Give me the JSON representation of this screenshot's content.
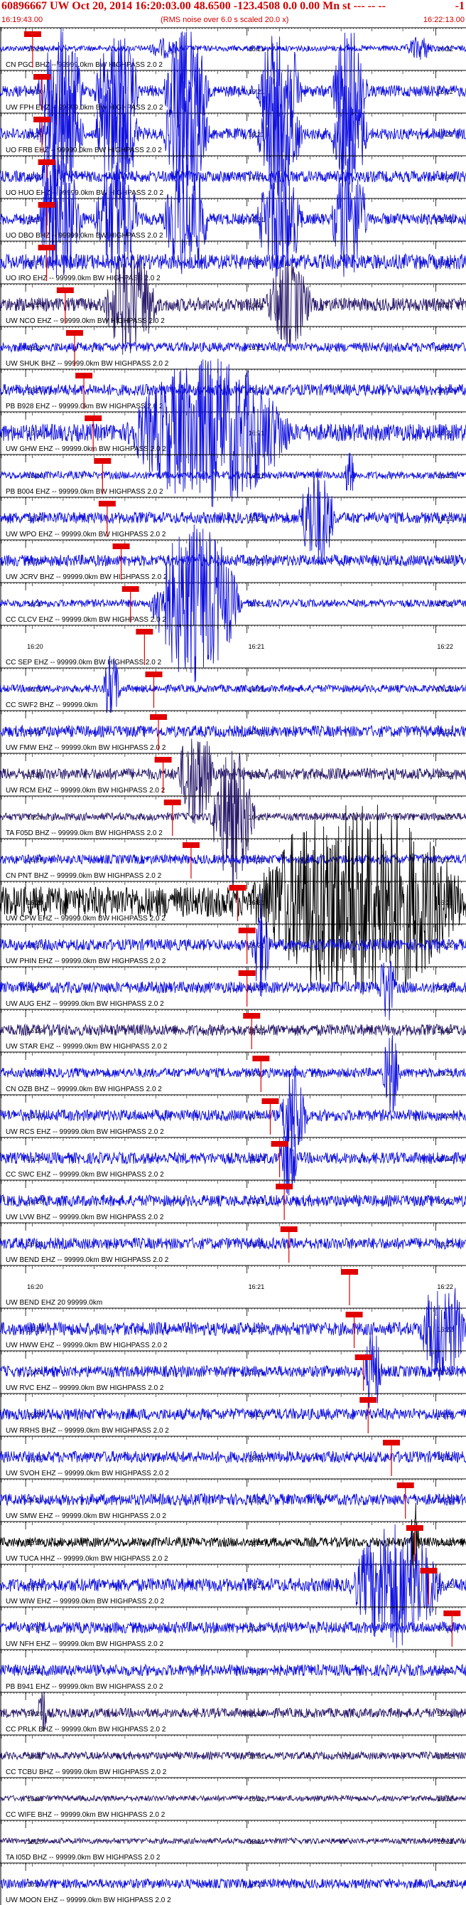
{
  "header": {
    "title": "60896667 UW Oct 20, 2014 16:20:03.00    48.6500 -123.4508  0.0 0.00 Mn st --- -- --",
    "flag": "-1",
    "note": "(RMS noise over 6.0 s scaled 20.0 x)",
    "start_time": "16:19:43.00",
    "end_time": "16:22:13.00"
  },
  "time_ticks": [
    "16:20",
    "16:21",
    "16:22"
  ],
  "colors": {
    "trace_blue": "#1010e0",
    "trace_navy": "#2a1a6a",
    "trace_black": "#000000",
    "pick_red": "#e00000",
    "axis": "#000000"
  },
  "channels": [
    {
      "label": "CN PGC BHZ -- 99999.0km BW  HIGHPASS  2.0  2",
      "color": "blue",
      "amp": 0.15,
      "pick": 0.07,
      "bursts": [
        [
          0.35,
          0.03,
          0.4
        ],
        [
          0.9,
          0.03,
          0.5
        ]
      ]
    },
    {
      "label": "UW FPH EHZ -- 99999.0km BW  HIGHPASS  2.0  2",
      "color": "blue",
      "amp": 0.3,
      "pick": 0.09,
      "bursts": [
        [
          0.13,
          0.05,
          3
        ],
        [
          0.25,
          0.05,
          3
        ],
        [
          0.4,
          0.05,
          3
        ],
        [
          0.6,
          0.05,
          3
        ],
        [
          0.75,
          0.04,
          3
        ]
      ]
    },
    {
      "label": "UO FRB EHZ -- 99999.0km BW  HIGHPASS  2.0  2",
      "color": "blue",
      "amp": 0.3,
      "pick": 0.09,
      "bursts": [
        [
          0.13,
          0.05,
          3
        ],
        [
          0.25,
          0.05,
          3
        ],
        [
          0.4,
          0.05,
          3
        ],
        [
          0.6,
          0.05,
          3
        ],
        [
          0.75,
          0.04,
          3
        ]
      ]
    },
    {
      "label": "UO HUO EHZ -- 99999.0km BW  HIGHPASS  2.0  2",
      "color": "blue",
      "amp": 0.3,
      "pick": 0.1,
      "bursts": [
        [
          0.11,
          0.02,
          3
        ]
      ]
    },
    {
      "label": "UO DBO BHZ -- 99999.0km BW  HIGHPASS  2.0  2",
      "color": "blue",
      "amp": 0.3,
      "pick": 0.1,
      "bursts": [
        [
          0.13,
          0.05,
          3
        ],
        [
          0.25,
          0.05,
          3
        ],
        [
          0.4,
          0.05,
          3
        ],
        [
          0.6,
          0.05,
          3
        ],
        [
          0.75,
          0.04,
          3
        ]
      ]
    },
    {
      "label": "UO IRO EHZ -- 99999.0km BW  HIGHPASS  2.0  2",
      "color": "blue",
      "amp": 0.4,
      "pick": 0.1,
      "bursts": []
    },
    {
      "label": "UW NCO EHZ -- 99999.0km BW  HIGHPASS  2.0  2",
      "color": "navy",
      "amp": 0.35,
      "pick": 0.14,
      "bursts": [
        [
          0.28,
          0.06,
          2.5
        ],
        [
          0.62,
          0.05,
          2
        ]
      ]
    },
    {
      "label": "UW SHUK BHZ -- 99999.0km BW  HIGHPASS  2.0  2",
      "color": "blue",
      "amp": 0.25,
      "pick": 0.16,
      "bursts": []
    },
    {
      "label": "PB B928 EHZ -- 99999.0km BW  HIGHPASS  2.0  2",
      "color": "blue",
      "amp": 0.3,
      "pick": 0.18,
      "bursts": []
    },
    {
      "label": "UW GHW EHZ -- 99999.0km BW  HIGHPASS  2.0  2",
      "color": "blue",
      "amp": 0.45,
      "pick": 0.2,
      "bursts": [
        [
          0.45,
          0.18,
          3.5
        ]
      ]
    },
    {
      "label": "PB B004 EHZ -- 99999.0km BW  HIGHPASS  2.0  2",
      "color": "blue",
      "amp": 0.2,
      "pick": 0.22,
      "bursts": [
        [
          0.75,
          0.01,
          1.8
        ]
      ]
    },
    {
      "label": "UW WPO EHZ -- 99999.0km BW  HIGHPASS  2.0  2",
      "color": "blue",
      "amp": 0.3,
      "pick": 0.23,
      "bursts": [
        [
          0.68,
          0.04,
          2.5
        ]
      ]
    },
    {
      "label": "UW JCRV BHZ -- 99999.0km BW  HIGHPASS  2.0  2",
      "color": "blue",
      "amp": 0.3,
      "pick": 0.26,
      "bursts": []
    },
    {
      "label": "CC CLCV EHZ -- 99999.0km BW  HIGHPASS  2.0  2",
      "color": "blue",
      "amp": 0.2,
      "pick": 0.28,
      "bursts": [
        [
          0.42,
          0.1,
          4
        ]
      ]
    },
    {
      "label": "CC SEP EHZ -- 99999.0km BW  HIGHPASS  2.0  2",
      "color": "blue",
      "amp": 0.0,
      "pick": 0.31,
      "bursts": []
    },
    {
      "label": "CC SWF2 BHZ -- 99999.0km",
      "color": "blue",
      "amp": 0.2,
      "pick": 0.33,
      "bursts": [
        [
          0.24,
          0.02,
          1.6
        ]
      ]
    },
    {
      "label": "UW FMW EHZ -- 99999.0km BW  HIGHPASS  2.0  2",
      "color": "blue",
      "amp": 0.3,
      "pick": 0.34,
      "bursts": []
    },
    {
      "label": "UW RCM EHZ -- 99999.0km BW  HIGHPASS  2.0  2",
      "color": "navy",
      "amp": 0.3,
      "pick": 0.35,
      "bursts": [
        [
          0.42,
          0.04,
          2.5
        ]
      ]
    },
    {
      "label": "TA F05D BHZ -- 99999.0km BW  HIGHPASS  2.0  2",
      "color": "navy",
      "amp": 0.2,
      "pick": 0.37,
      "bursts": [
        [
          0.5,
          0.05,
          3.5
        ]
      ]
    },
    {
      "label": "CN PNT BHZ -- 99999.0km BW  HIGHPASS  2.0  2",
      "color": "blue",
      "amp": 0.25,
      "pick": 0.41,
      "bursts": []
    },
    {
      "label": "UW CPW EHZ -- 99999.0km BW  HIGHPASS  2.0  2",
      "color": "black",
      "amp": 0.8,
      "pick": 0.51,
      "bursts": [
        [
          0.77,
          0.23,
          4.5
        ]
      ]
    },
    {
      "label": "UW PHIN EHZ -- 99999.0km BW  HIGHPASS  2.0  2",
      "color": "blue",
      "amp": 0.3,
      "pick": 0.53,
      "bursts": [
        [
          0.56,
          0.02,
          2.5
        ]
      ]
    },
    {
      "label": "UW AUG EHZ -- 99999.0km BW  HIGHPASS  2.0  2",
      "color": "blue",
      "amp": 0.3,
      "pick": 0.53,
      "bursts": [
        [
          0.83,
          0.02,
          1.6
        ]
      ]
    },
    {
      "label": "UW STAR EHZ -- 99999.0km BW  HIGHPASS  2.0  2",
      "color": "navy",
      "amp": 0.3,
      "pick": 0.54,
      "bursts": []
    },
    {
      "label": "CN OZB BHZ -- 99999.0km BW  HIGHPASS  2.0  2",
      "color": "blue",
      "amp": 0.25,
      "pick": 0.56,
      "bursts": [
        [
          0.84,
          0.02,
          2
        ]
      ]
    },
    {
      "label": "UW RCS EHZ -- 99999.0km BW  HIGHPASS  2.0  2",
      "color": "blue",
      "amp": 0.3,
      "pick": 0.58,
      "bursts": [
        [
          0.63,
          0.03,
          2.5
        ]
      ]
    },
    {
      "label": "CC SWC EHZ -- 99999.0km BW  HIGHPASS  2.0  2",
      "color": "blue",
      "amp": 0.3,
      "pick": 0.6,
      "bursts": [
        [
          0.62,
          0.02,
          2
        ]
      ]
    },
    {
      "label": "UW LVW BHZ -- 99999.0km BW  HIGHPASS  2.0  2",
      "color": "blue",
      "amp": 0.3,
      "pick": 0.61,
      "bursts": []
    },
    {
      "label": "UW BEND EHZ -- 99999.0km BW  HIGHPASS  2.0  2",
      "color": "blue",
      "amp": 0.3,
      "pick": 0.62,
      "bursts": []
    },
    {
      "label": "UW BEND EHZ 20 99999.0km",
      "color": "blue",
      "amp": 0.0,
      "pick": 0.75,
      "bursts": []
    },
    {
      "label": "UW HWW EHZ -- 99999.0km BW  HIGHPASS  2.0  2",
      "color": "blue",
      "amp": 0.35,
      "pick": 0.76,
      "bursts": [
        [
          0.95,
          0.05,
          2.5
        ]
      ]
    },
    {
      "label": "UW RVC EHZ -- 99999.0km BW  HIGHPASS  2.0  2",
      "color": "blue",
      "amp": 0.3,
      "pick": 0.78,
      "bursts": [
        [
          0.8,
          0.02,
          2
        ]
      ]
    },
    {
      "label": "UW RRHS BHZ -- 99999.0km BW  HIGHPASS  2.0  2",
      "color": "blue",
      "amp": 0.3,
      "pick": 0.79,
      "bursts": []
    },
    {
      "label": "UW SVOH EHZ -- 99999.0km BW  HIGHPASS  2.0  2",
      "color": "blue",
      "amp": 0.3,
      "pick": 0.84,
      "bursts": []
    },
    {
      "label": "UW SMW EHZ -- 99999.0km BW  HIGHPASS  2.0  2",
      "color": "blue",
      "amp": 0.3,
      "pick": 0.87,
      "bursts": []
    },
    {
      "label": "UW TUCA HHZ -- 99999.0km BW  HIGHPASS  2.0  2",
      "color": "black",
      "amp": 0.25,
      "pick": 0.89,
      "bursts": [
        [
          0.89,
          0.01,
          2
        ]
      ]
    },
    {
      "label": "UW WIW EHZ -- 99999.0km BW  HIGHPASS  2.0  2",
      "color": "blue",
      "amp": 0.35,
      "pick": 0.92,
      "bursts": [
        [
          0.85,
          0.1,
          3
        ]
      ]
    },
    {
      "label": "UW NFH EHZ -- 99999.0km BW  HIGHPASS  2.0  2",
      "color": "blue",
      "amp": 0.3,
      "pick": 0.97,
      "bursts": []
    },
    {
      "label": "PB B941 EHZ -- 99999.0km BW  HIGHPASS  2.0  2",
      "color": "blue",
      "amp": 0.3,
      "pick": null,
      "bursts": []
    },
    {
      "label": "CC PRLK BHZ -- 99999.0km BW  HIGHPASS  2.0  2",
      "color": "navy",
      "amp": 0.25,
      "pick": null,
      "bursts": [
        [
          0.09,
          0.01,
          1.5
        ]
      ]
    },
    {
      "label": "CC TCBU BHZ -- 99999.0km BW  HIGHPASS  2.0  2",
      "color": "navy",
      "amp": 0.2,
      "pick": null,
      "bursts": []
    },
    {
      "label": "CC WIFE BHZ -- 99999.0km BW  HIGHPASS  2.0  2",
      "color": "navy",
      "amp": 0.15,
      "pick": null,
      "bursts": []
    },
    {
      "label": "TA I05D BHZ -- 99999.0km BW  HIGHPASS  2.0  2",
      "color": "navy",
      "amp": 0.15,
      "pick": null,
      "bursts": []
    },
    {
      "label": "UW MOON EHZ -- 99999.0km BW  HIGHPASS  2.0  2",
      "color": "blue",
      "amp": 0.25,
      "pick": null,
      "bursts": []
    }
  ]
}
